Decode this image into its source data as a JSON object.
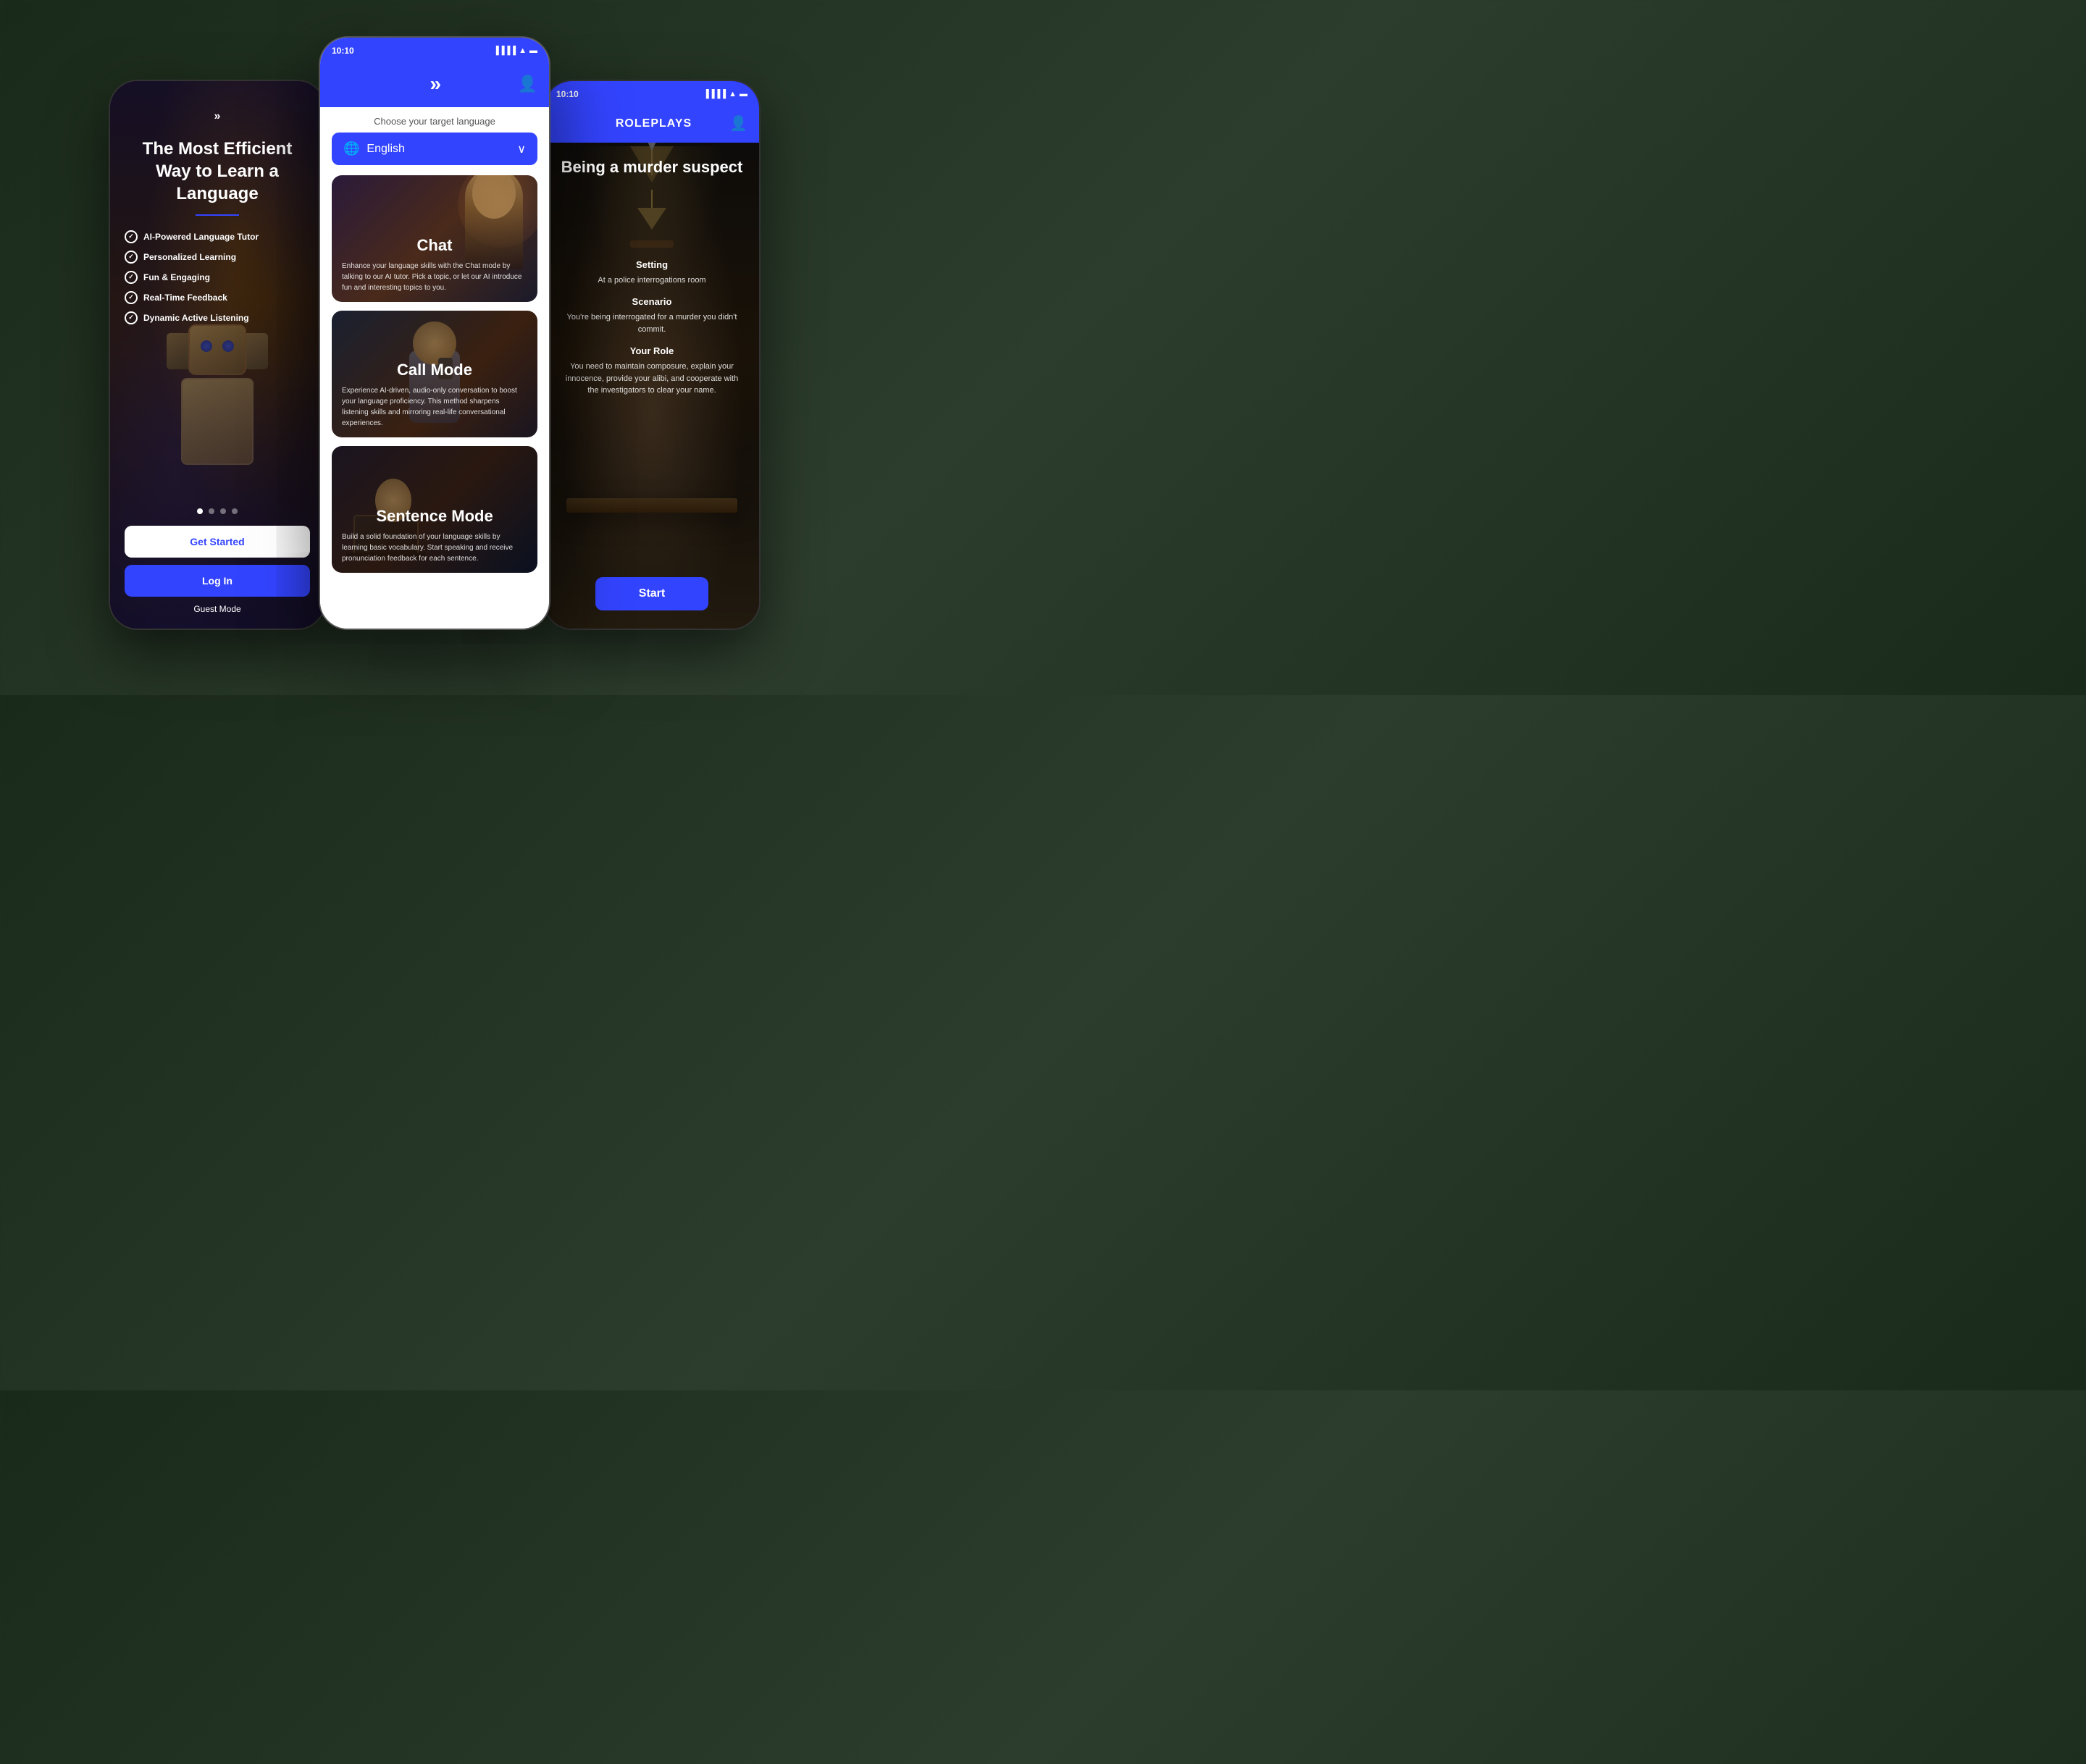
{
  "left_phone": {
    "logo": "»",
    "hero_title": "The Most Efficient Way to Learn a Language",
    "features": [
      "AI-Powered Language Tutor",
      "Personalized Learning",
      "Fun & Engaging",
      "Real-Time Feedback",
      "Dynamic Active Listening"
    ],
    "btn_get_started": "Get Started",
    "btn_login": "Log In",
    "guest_mode": "Guest Mode"
  },
  "center_phone": {
    "status_time": "10:10",
    "logo": "»",
    "target_lang_label": "Choose your target language",
    "language": "English",
    "modes": [
      {
        "title": "Chat",
        "description": "Enhance your language skills with the Chat mode by talking to our AI tutor. Pick a topic, or let our AI introduce fun and interesting topics to you."
      },
      {
        "title": "Call Mode",
        "description": "Experience AI-driven, audio-only conversation to boost your language proficiency. This method sharpens listening skills and mirroring real-life conversational experiences."
      },
      {
        "title": "Sentence Mode",
        "description": "Build a solid foundation of your language skills by learning basic vocabulary. Start speaking and receive pronunciation feedback for each sentence."
      }
    ]
  },
  "right_phone": {
    "status_time": "10:10",
    "header_title": "ROLEPLAYS",
    "roleplay_title": "Being a murder suspect",
    "setting_label": "Setting",
    "setting_value": "At a police interrogations room",
    "scenario_label": "Scenario",
    "scenario_value": "You're being interrogated for a murder you didn't commit.",
    "your_role_label": "Your Role",
    "your_role_value": "You need to maintain composure, explain your innocence, provide your alibi, and cooperate with the investigators to clear your name.",
    "btn_start": "Start"
  }
}
